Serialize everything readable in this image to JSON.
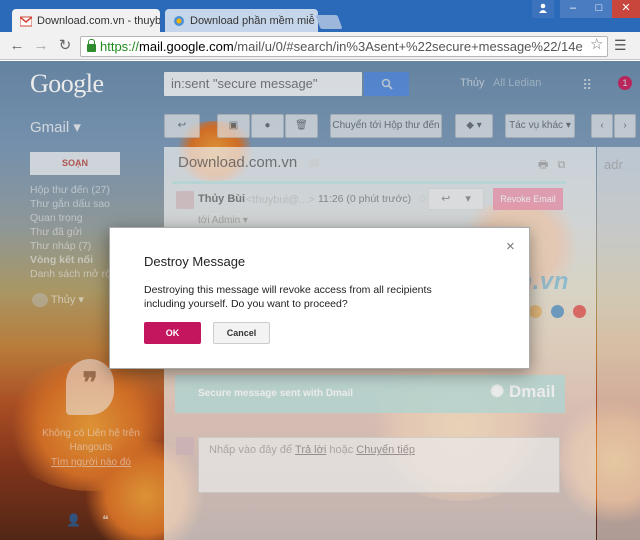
{
  "browser": {
    "tabs": [
      {
        "title": "Download.com.vn - thuyb",
        "close": "×"
      },
      {
        "title": "Download phần mềm miễ",
        "close": "×"
      }
    ],
    "window_controls": {
      "minimize": "–",
      "restore": "□",
      "close": "✕"
    },
    "address": {
      "scheme": "https://",
      "host": "mail.google.com",
      "path": "/mail/u/0/#search/in%3Asent+%22secure+message%22/14e"
    }
  },
  "gmail": {
    "logo": "Google",
    "search_value": "in:sent \"secure message\"",
    "user_name": "Thủy",
    "all_label": "All Ledian",
    "notification_count": "1",
    "app_label": "Gmail",
    "compose_label": "SOẠN",
    "nav_items": [
      {
        "label": "Hộp thư đến (27)",
        "bold": false
      },
      {
        "label": "Thư gắn dấu sao",
        "bold": false
      },
      {
        "label": "Quan trọng",
        "bold": false
      },
      {
        "label": "Thư đã gửi",
        "bold": false
      },
      {
        "label": "Thư nháp (7)",
        "bold": false
      },
      {
        "label": "Vòng kết nối",
        "bold": true
      },
      {
        "label": "Danh sách mở rộ",
        "bold": false
      }
    ],
    "account_label": "Thủy",
    "hangouts_text": "Không có Liên hệ trên Hangouts",
    "hangouts_link": "Tìm người nào đó",
    "toolbar": {
      "move_to_inbox": "Chuyển tới Hộp thư đến",
      "more_actions": "Tác vụ khác"
    },
    "message": {
      "subject": "Download.com.vn",
      "sender": "Thủy Bùi",
      "sender_email": "<thuybui@...>",
      "time": "11:26 (0 phút trước)",
      "revoke_label": "Revoke Email",
      "to_line": "tới Admin",
      "secure_banner": "Secure message sent with Dmail",
      "dmail_brand": "Dmail",
      "reply_prompt": "Nhấp vào đây để",
      "reply_link": "Trả lời",
      "reply_or": "hoặc",
      "forward_link": "Chuyển tiếp"
    },
    "right_pane_label": "adr",
    "watermark": "Download.com.vn"
  },
  "dialog": {
    "title": "Destroy Message",
    "body": "Destroying this message will revoke access from all recipients including yourself. Do you want to proceed?",
    "ok_label": "OK",
    "cancel_label": "Cancel",
    "close": "×"
  },
  "colors": {
    "accent": "#c4165f",
    "dmail_teal": "#bfe6e4",
    "chrome_frame": "#2a6ab8"
  },
  "watermark_dots": [
    "#5ab7e6",
    "#cfcfcf",
    "#9fd67e",
    "#f2b96a",
    "#4d90c8",
    "#e94b4b"
  ]
}
